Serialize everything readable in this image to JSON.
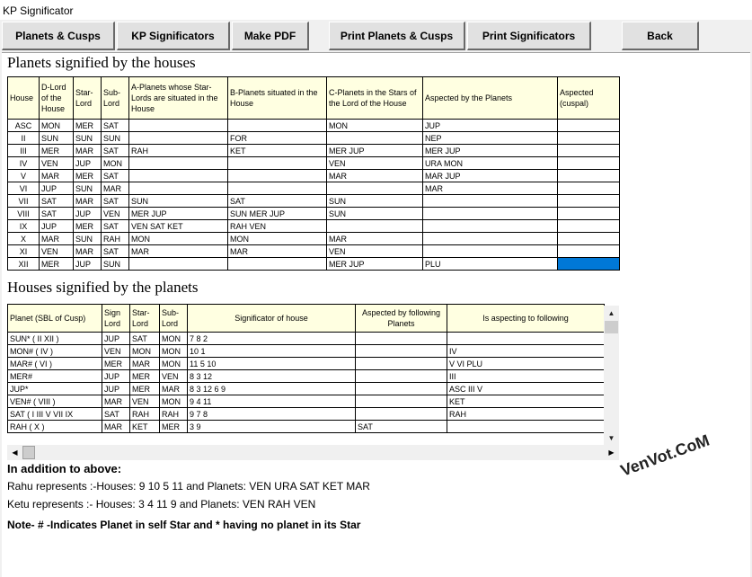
{
  "window": {
    "title": "KP Significator"
  },
  "toolbar": {
    "buttons": [
      "Planets & Cusps",
      "KP Significators",
      "Make PDF",
      "Print Planets & Cusps",
      "Print  Significators",
      "Back"
    ]
  },
  "houses_section": {
    "title": "Planets signified by the houses",
    "headers": [
      "House",
      "D-Lord of the House",
      "Star-Lord",
      "Sub-Lord",
      "A-Planets whose Star-Lords are situated in the House",
      "B-Planets situated in the House",
      "C-Planets in the Stars of the Lord of the House",
      "Aspected by the Planets",
      "Aspected (cuspal)"
    ],
    "rows": [
      [
        "ASC",
        "MON",
        "MER",
        "SAT",
        "",
        "",
        "MON",
        "JUP",
        ""
      ],
      [
        "II",
        "SUN",
        "SUN",
        "SUN",
        "",
        "FOR",
        "",
        "NEP",
        ""
      ],
      [
        "III",
        "MER",
        "MAR",
        "SAT",
        "RAH",
        "KET",
        "MER JUP",
        "MER JUP",
        ""
      ],
      [
        "IV",
        "VEN",
        "JUP",
        "MON",
        "",
        "",
        "VEN",
        "URA MON",
        ""
      ],
      [
        "V",
        "MAR",
        "MER",
        "SAT",
        "",
        "",
        "MAR",
        "MAR JUP",
        ""
      ],
      [
        "VI",
        "JUP",
        "SUN",
        "MAR",
        "",
        "",
        "",
        "MAR",
        ""
      ],
      [
        "VII",
        "SAT",
        "MAR",
        "SAT",
        "SUN",
        "SAT",
        "SUN",
        "",
        ""
      ],
      [
        "VIII",
        "SAT",
        "JUP",
        "VEN",
        "MER JUP",
        "SUN MER JUP",
        "SUN",
        "",
        ""
      ],
      [
        "IX",
        "JUP",
        "MER",
        "SAT",
        "VEN SAT KET",
        "RAH VEN",
        "",
        "",
        ""
      ],
      [
        "X",
        "MAR",
        "SUN",
        "RAH",
        "MON",
        "MON",
        "MAR",
        "",
        ""
      ],
      [
        "XI",
        "VEN",
        "MAR",
        "SAT",
        "MAR",
        "MAR",
        "VEN",
        "",
        ""
      ],
      [
        "XII",
        "MER",
        "JUP",
        "SUN",
        "",
        "",
        "MER JUP",
        "PLU",
        ""
      ]
    ]
  },
  "planets_section": {
    "title": "Houses signified by the planets",
    "headers": [
      "Planet (SBL of Cusp)",
      "Sign Lord",
      "Star-Lord",
      "Sub-Lord",
      "Significator of house",
      "Aspected by following Planets",
      "Is aspecting to following"
    ],
    "rows": [
      [
        "SUN* ( II  XII )",
        "JUP",
        "SAT",
        "MON",
        "7  8  2",
        "",
        ""
      ],
      [
        "MON# ( IV )",
        "VEN",
        "MON",
        "MON",
        "10  1",
        "",
        "IV"
      ],
      [
        "MAR# ( VI )",
        "MER",
        "MAR",
        "MON",
        "11  5  10",
        "",
        "V  VI  PLU"
      ],
      [
        "MER#",
        "JUP",
        "MER",
        "VEN",
        "8  3  12",
        "",
        "III"
      ],
      [
        "JUP*",
        "JUP",
        "MER",
        "MAR",
        "8  3  12  6  9",
        "",
        "ASC III  V"
      ],
      [
        "VEN# ( VIII )",
        "MAR",
        "VEN",
        "MON",
        "9  4  11",
        "",
        "KET"
      ],
      [
        "SAT ( I  III  V  VII  IX",
        "SAT",
        "RAH",
        "RAH",
        "9  7  8",
        "",
        "RAH"
      ],
      [
        "RAH ( X )",
        "MAR",
        "KET",
        "MER",
        "3  9",
        "SAT",
        ""
      ]
    ]
  },
  "addition": {
    "heading": "In addition to above:",
    "rahu": "Rahu represents :-Houses: 9 10 5 11  and Planets:  VEN URA SAT KET MAR",
    "ketu": "Ketu represents  :-  Houses: 3 4 11 9   and Planets:  VEN RAH VEN"
  },
  "note": "Note- # -Indicates Planet in self Star and * having no planet in its Star",
  "watermark": "VenVot.CoM",
  "colors": {
    "header_bg": "#ffffe1",
    "selected_cell": "#0078d7"
  },
  "icons": {
    "scroll_up": "triangle-up",
    "scroll_down": "triangle-down",
    "scroll_left": "triangle-left",
    "scroll_right": "triangle-right"
  }
}
